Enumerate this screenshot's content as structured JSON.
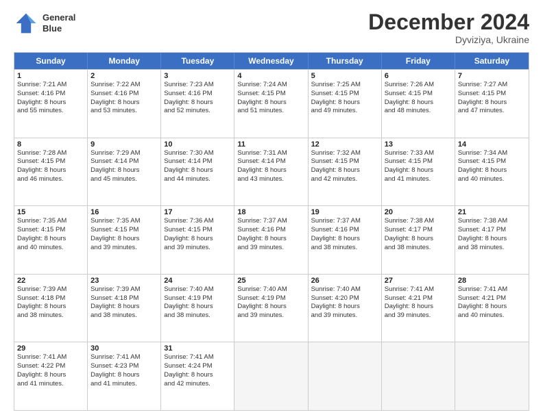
{
  "header": {
    "logo_line1": "General",
    "logo_line2": "Blue",
    "month": "December 2024",
    "location": "Dyviziya, Ukraine"
  },
  "days_of_week": [
    "Sunday",
    "Monday",
    "Tuesday",
    "Wednesday",
    "Thursday",
    "Friday",
    "Saturday"
  ],
  "rows": [
    [
      {
        "day": "1",
        "lines": [
          "Sunrise: 7:21 AM",
          "Sunset: 4:16 PM",
          "Daylight: 8 hours",
          "and 55 minutes."
        ]
      },
      {
        "day": "2",
        "lines": [
          "Sunrise: 7:22 AM",
          "Sunset: 4:16 PM",
          "Daylight: 8 hours",
          "and 53 minutes."
        ]
      },
      {
        "day": "3",
        "lines": [
          "Sunrise: 7:23 AM",
          "Sunset: 4:16 PM",
          "Daylight: 8 hours",
          "and 52 minutes."
        ]
      },
      {
        "day": "4",
        "lines": [
          "Sunrise: 7:24 AM",
          "Sunset: 4:15 PM",
          "Daylight: 8 hours",
          "and 51 minutes."
        ]
      },
      {
        "day": "5",
        "lines": [
          "Sunrise: 7:25 AM",
          "Sunset: 4:15 PM",
          "Daylight: 8 hours",
          "and 49 minutes."
        ]
      },
      {
        "day": "6",
        "lines": [
          "Sunrise: 7:26 AM",
          "Sunset: 4:15 PM",
          "Daylight: 8 hours",
          "and 48 minutes."
        ]
      },
      {
        "day": "7",
        "lines": [
          "Sunrise: 7:27 AM",
          "Sunset: 4:15 PM",
          "Daylight: 8 hours",
          "and 47 minutes."
        ]
      }
    ],
    [
      {
        "day": "8",
        "lines": [
          "Sunrise: 7:28 AM",
          "Sunset: 4:15 PM",
          "Daylight: 8 hours",
          "and 46 minutes."
        ]
      },
      {
        "day": "9",
        "lines": [
          "Sunrise: 7:29 AM",
          "Sunset: 4:14 PM",
          "Daylight: 8 hours",
          "and 45 minutes."
        ]
      },
      {
        "day": "10",
        "lines": [
          "Sunrise: 7:30 AM",
          "Sunset: 4:14 PM",
          "Daylight: 8 hours",
          "and 44 minutes."
        ]
      },
      {
        "day": "11",
        "lines": [
          "Sunrise: 7:31 AM",
          "Sunset: 4:14 PM",
          "Daylight: 8 hours",
          "and 43 minutes."
        ]
      },
      {
        "day": "12",
        "lines": [
          "Sunrise: 7:32 AM",
          "Sunset: 4:15 PM",
          "Daylight: 8 hours",
          "and 42 minutes."
        ]
      },
      {
        "day": "13",
        "lines": [
          "Sunrise: 7:33 AM",
          "Sunset: 4:15 PM",
          "Daylight: 8 hours",
          "and 41 minutes."
        ]
      },
      {
        "day": "14",
        "lines": [
          "Sunrise: 7:34 AM",
          "Sunset: 4:15 PM",
          "Daylight: 8 hours",
          "and 40 minutes."
        ]
      }
    ],
    [
      {
        "day": "15",
        "lines": [
          "Sunrise: 7:35 AM",
          "Sunset: 4:15 PM",
          "Daylight: 8 hours",
          "and 40 minutes."
        ]
      },
      {
        "day": "16",
        "lines": [
          "Sunrise: 7:35 AM",
          "Sunset: 4:15 PM",
          "Daylight: 8 hours",
          "and 39 minutes."
        ]
      },
      {
        "day": "17",
        "lines": [
          "Sunrise: 7:36 AM",
          "Sunset: 4:15 PM",
          "Daylight: 8 hours",
          "and 39 minutes."
        ]
      },
      {
        "day": "18",
        "lines": [
          "Sunrise: 7:37 AM",
          "Sunset: 4:16 PM",
          "Daylight: 8 hours",
          "and 39 minutes."
        ]
      },
      {
        "day": "19",
        "lines": [
          "Sunrise: 7:37 AM",
          "Sunset: 4:16 PM",
          "Daylight: 8 hours",
          "and 38 minutes."
        ]
      },
      {
        "day": "20",
        "lines": [
          "Sunrise: 7:38 AM",
          "Sunset: 4:17 PM",
          "Daylight: 8 hours",
          "and 38 minutes."
        ]
      },
      {
        "day": "21",
        "lines": [
          "Sunrise: 7:38 AM",
          "Sunset: 4:17 PM",
          "Daylight: 8 hours",
          "and 38 minutes."
        ]
      }
    ],
    [
      {
        "day": "22",
        "lines": [
          "Sunrise: 7:39 AM",
          "Sunset: 4:18 PM",
          "Daylight: 8 hours",
          "and 38 minutes."
        ]
      },
      {
        "day": "23",
        "lines": [
          "Sunrise: 7:39 AM",
          "Sunset: 4:18 PM",
          "Daylight: 8 hours",
          "and 38 minutes."
        ]
      },
      {
        "day": "24",
        "lines": [
          "Sunrise: 7:40 AM",
          "Sunset: 4:19 PM",
          "Daylight: 8 hours",
          "and 38 minutes."
        ]
      },
      {
        "day": "25",
        "lines": [
          "Sunrise: 7:40 AM",
          "Sunset: 4:19 PM",
          "Daylight: 8 hours",
          "and 39 minutes."
        ]
      },
      {
        "day": "26",
        "lines": [
          "Sunrise: 7:40 AM",
          "Sunset: 4:20 PM",
          "Daylight: 8 hours",
          "and 39 minutes."
        ]
      },
      {
        "day": "27",
        "lines": [
          "Sunrise: 7:41 AM",
          "Sunset: 4:21 PM",
          "Daylight: 8 hours",
          "and 39 minutes."
        ]
      },
      {
        "day": "28",
        "lines": [
          "Sunrise: 7:41 AM",
          "Sunset: 4:21 PM",
          "Daylight: 8 hours",
          "and 40 minutes."
        ]
      }
    ],
    [
      {
        "day": "29",
        "lines": [
          "Sunrise: 7:41 AM",
          "Sunset: 4:22 PM",
          "Daylight: 8 hours",
          "and 41 minutes."
        ]
      },
      {
        "day": "30",
        "lines": [
          "Sunrise: 7:41 AM",
          "Sunset: 4:23 PM",
          "Daylight: 8 hours",
          "and 41 minutes."
        ]
      },
      {
        "day": "31",
        "lines": [
          "Sunrise: 7:41 AM",
          "Sunset: 4:24 PM",
          "Daylight: 8 hours",
          "and 42 minutes."
        ]
      },
      {
        "day": "",
        "lines": []
      },
      {
        "day": "",
        "lines": []
      },
      {
        "day": "",
        "lines": []
      },
      {
        "day": "",
        "lines": []
      }
    ]
  ]
}
